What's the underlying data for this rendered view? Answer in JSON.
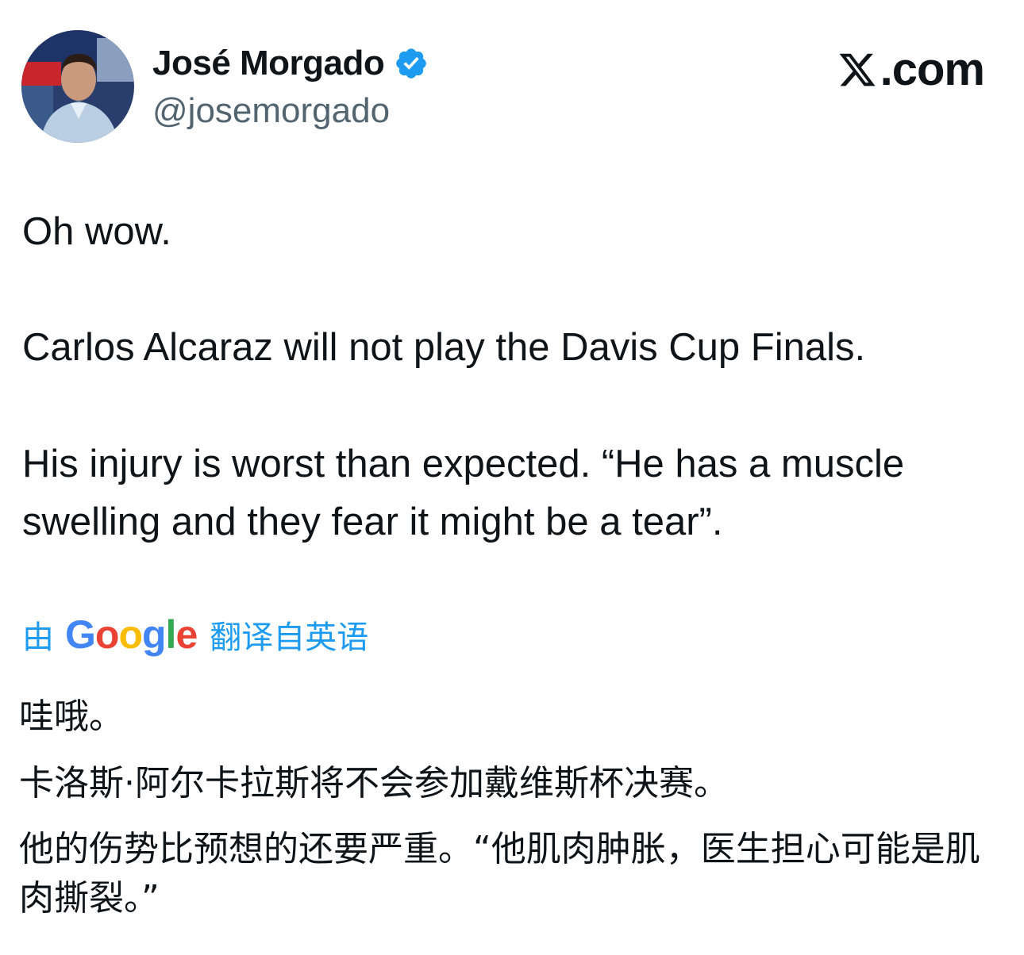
{
  "tweet": {
    "author": {
      "display_name": "José Morgado",
      "handle": "@josemorgado",
      "verified_icon": "verified-badge-icon",
      "avatar_icon": "avatar"
    },
    "brand": {
      "logo_icon": "x-logo-icon",
      "suffix": ".com"
    },
    "text": {
      "line1": "Oh wow.",
      "line2": "Carlos Alcaraz will not play the Davis Cup Finals.",
      "line3": "His injury is worst than expected. “He has a muscle swelling and they fear it might be a tear”."
    },
    "translation": {
      "prefix": "由",
      "provider": "Google",
      "suffix": "翻译自英语",
      "line1": "哇哦。",
      "line2": "卡洛斯·阿尔卡拉斯将不会参加戴维斯杯决赛。",
      "line3": "他的伤势比预想的还要严重。“他肌肉肿胀，医生担心可能是肌肉撕裂。”"
    }
  },
  "colors": {
    "text": "#0f1419",
    "secondary": "#536471",
    "accent": "#1d9bf0",
    "google_blue": "#4285f4",
    "google_red": "#ea4335",
    "google_yellow": "#fbbc05",
    "google_green": "#34a853"
  }
}
